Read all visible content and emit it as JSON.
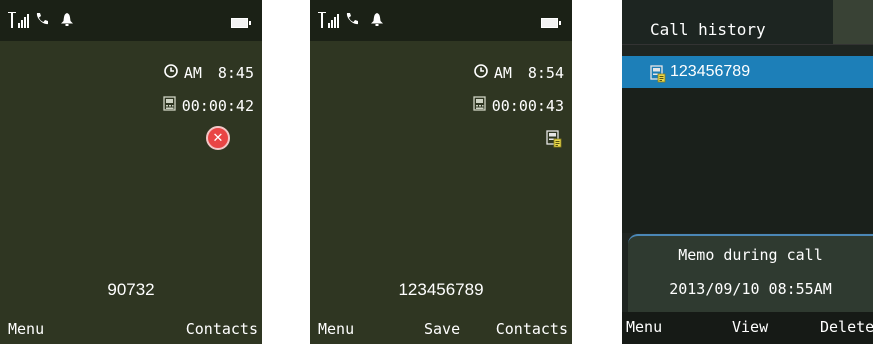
{
  "screens": [
    {
      "time_icon": "clock-icon",
      "ampm": "AM",
      "time": "8:45",
      "duration_icon": "memo-card-icon",
      "duration": "00:00:42",
      "status_icon": "error-x-icon",
      "number": "90732",
      "softkeys": {
        "left": "Menu",
        "right": "Contacts"
      }
    },
    {
      "time_icon": "clock-icon",
      "ampm": "AM",
      "time": "8:54",
      "duration_icon": "memo-card-icon",
      "duration": "00:00:43",
      "status_icon": "memo-saved-icon",
      "number": "123456789",
      "softkeys": {
        "left": "Menu",
        "middle": "Save",
        "right": "Contacts"
      }
    },
    {
      "title": "Call history",
      "selected_item": "123456789",
      "selected_item_icon": "memo-card-icon",
      "memo_title": "Memo during call",
      "memo_date": "2013/09/10 08:55AM",
      "softkeys": {
        "left": "Menu",
        "middle": "View",
        "right": "Delete"
      }
    }
  ],
  "status_icons": [
    "signal-icon",
    "phone-icon",
    "bell-icon",
    "battery-icon"
  ],
  "colors": {
    "screen_bg": "#2f3622",
    "status_bar": "#1b2116",
    "highlight": "#1d7fb8",
    "text": "#ffffff"
  }
}
